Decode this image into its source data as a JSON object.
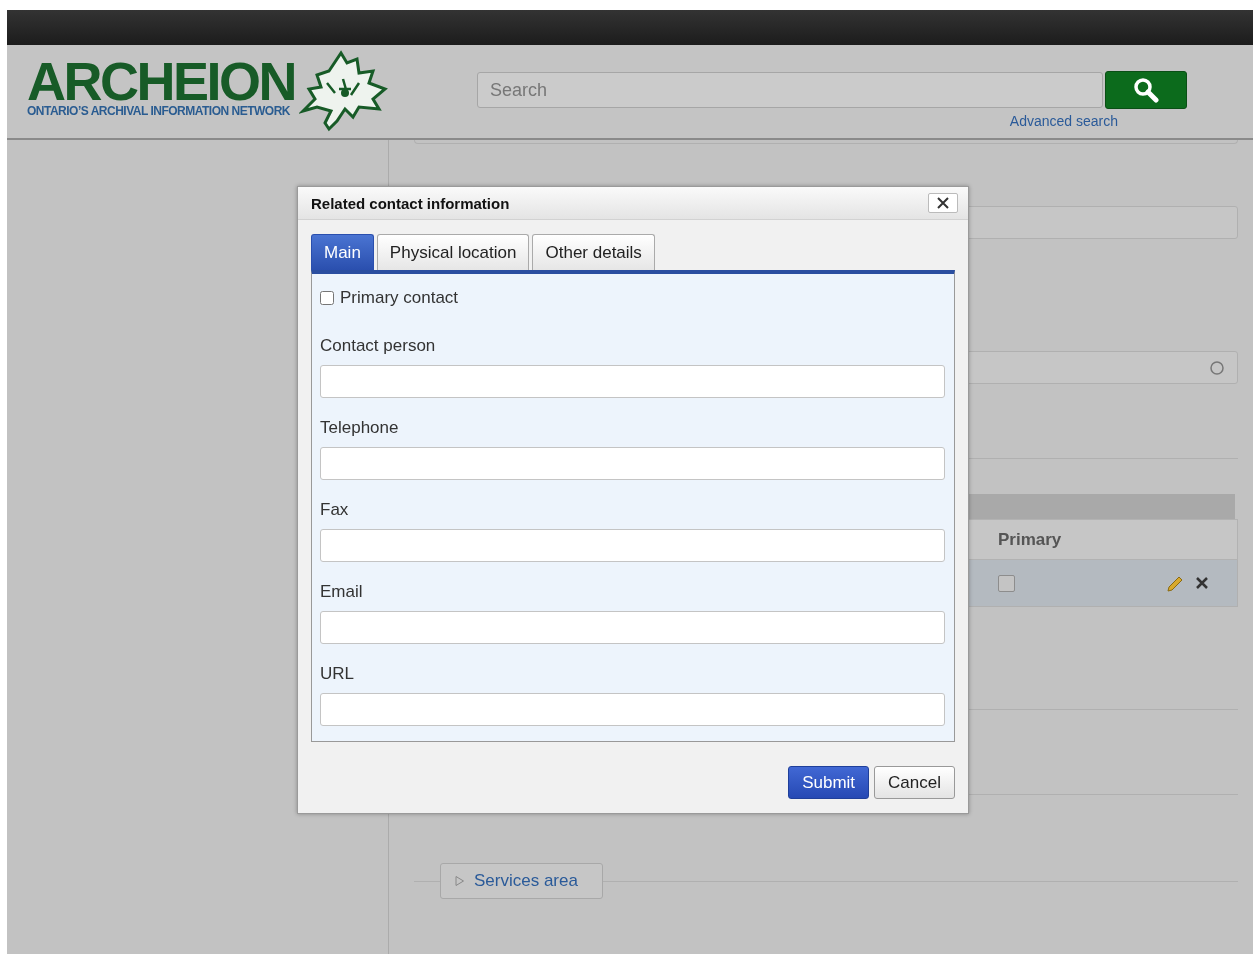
{
  "header": {
    "logo_title": "ARCHEION",
    "logo_tagline": "ONTARIO’S ARCHIVAL INFORMATION NETWORK",
    "search": {
      "placeholder": "Search"
    },
    "advanced_search": "Advanced search"
  },
  "background": {
    "table": {
      "columns": [
        "Primary"
      ],
      "rows": [
        {
          "primary_checked": false
        }
      ]
    },
    "sections": [
      {
        "label": "Services area",
        "expanded": false
      }
    ]
  },
  "dialog": {
    "title": "Related contact information",
    "tabs": [
      {
        "label": "Main",
        "selected": true
      },
      {
        "label": "Physical location",
        "selected": false
      },
      {
        "label": "Other details",
        "selected": false
      }
    ],
    "fields": [
      {
        "kind": "checkbox",
        "label": "Primary contact",
        "checked": false
      },
      {
        "kind": "text",
        "label": "Contact person"
      },
      {
        "kind": "text",
        "label": "Telephone"
      },
      {
        "kind": "text",
        "label": "Fax"
      },
      {
        "kind": "text",
        "label": "Email"
      },
      {
        "kind": "text",
        "label": "URL"
      }
    ],
    "buttons": [
      {
        "label": "Submit",
        "kind": "primary"
      },
      {
        "label": "Cancel",
        "kind": "secondary"
      }
    ]
  }
}
